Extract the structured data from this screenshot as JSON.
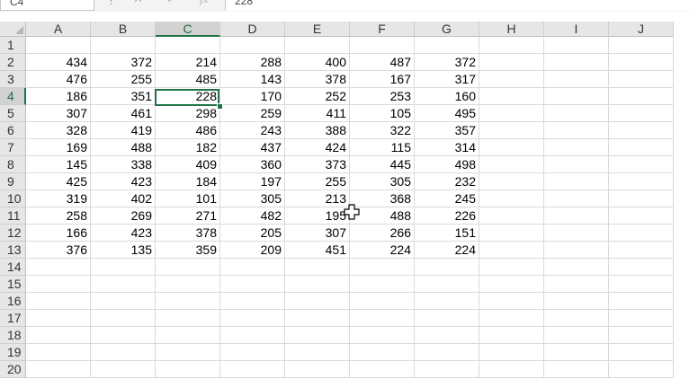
{
  "formula_bar": {
    "name_box": "C4",
    "fx_label": "fx",
    "value": "228"
  },
  "columns": [
    "A",
    "B",
    "C",
    "D",
    "E",
    "F",
    "G",
    "H",
    "I",
    "J"
  ],
  "selected_column": "C",
  "selected_row": 4,
  "rows": [
    1,
    2,
    3,
    4,
    5,
    6,
    7,
    8,
    9,
    10,
    11,
    12,
    13,
    14,
    15,
    16,
    17,
    18,
    19,
    20
  ],
  "cells": [
    [],
    [
      434,
      372,
      214,
      288,
      400,
      487,
      372
    ],
    [
      476,
      255,
      485,
      143,
      378,
      167,
      317
    ],
    [
      186,
      351,
      228,
      170,
      252,
      253,
      160
    ],
    [
      307,
      461,
      298,
      259,
      411,
      105,
      495
    ],
    [
      328,
      419,
      486,
      243,
      388,
      322,
      357
    ],
    [
      169,
      488,
      182,
      437,
      424,
      115,
      314
    ],
    [
      145,
      338,
      409,
      360,
      373,
      445,
      498
    ],
    [
      425,
      423,
      184,
      197,
      255,
      305,
      232
    ],
    [
      319,
      402,
      101,
      305,
      213,
      368,
      245
    ],
    [
      258,
      269,
      271,
      482,
      195,
      488,
      226
    ],
    [
      166,
      423,
      378,
      205,
      307,
      266,
      151
    ],
    [
      376,
      135,
      359,
      209,
      451,
      224,
      224
    ],
    [],
    [],
    [],
    [],
    [],
    [],
    [],
    []
  ]
}
